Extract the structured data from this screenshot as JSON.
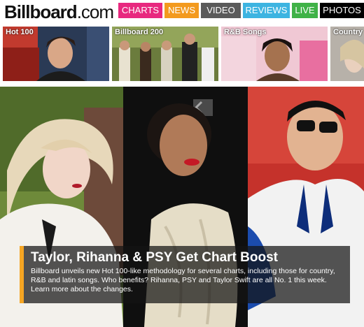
{
  "site": {
    "logo_part1": "Bill",
    "logo_part2": "board",
    "logo_part3": ".com"
  },
  "nav": [
    {
      "label": "CHARTS",
      "color": "#e8297f"
    },
    {
      "label": "NEWS",
      "color": "#f39a1e"
    },
    {
      "label": "VIDEO",
      "color": "#5a5a5a"
    },
    {
      "label": "REVIEWS",
      "color": "#3db4e1"
    },
    {
      "label": "LIVE",
      "color": "#3fb247"
    },
    {
      "label": "PHOTOS",
      "color": "#000000"
    }
  ],
  "charts": [
    {
      "label": "Hot 100"
    },
    {
      "label": "Billboard 200"
    },
    {
      "label": "R&B Songs"
    },
    {
      "label": "Country"
    }
  ],
  "feature": {
    "title": "Taylor, Rihanna & PSY Get Chart Boost",
    "text": "Billboard unveils new Hot 100-like methodology for several charts, including those for country, R&B and latin songs. Who benefits? Rihanna, PSY and Taylor Swift are all No. 1 this week. Learn more about the changes."
  },
  "colors": {
    "caption_accent": "#f6a623"
  }
}
